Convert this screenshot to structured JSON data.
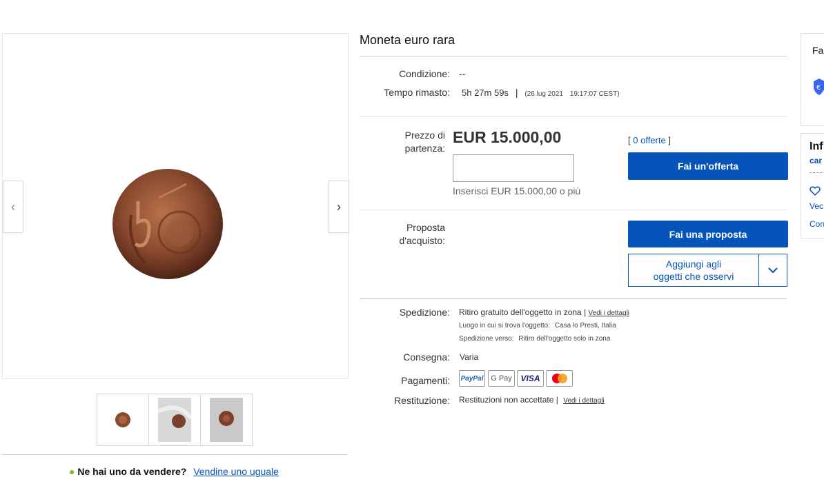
{
  "listing": {
    "title": "Moneta euro rara",
    "condition_label": "Condizione:",
    "condition_value": "--",
    "time_label": "Tempo rimasto:",
    "time_value": "5h 27m 59s",
    "time_separator": "|",
    "end_date": "(26 lug 2021",
    "end_time": "19:17:07 CEST)"
  },
  "bid": {
    "price_label_line1": "Prezzo di",
    "price_label_line2": "partenza:",
    "price": "EUR 15.000,00",
    "offers_open": "[",
    "offers": "0 offerte",
    "offers_close": "]",
    "place_bid_button": "Fai un'offerta",
    "input_value": "",
    "hint": "Inserisci EUR 15.000,00 o più"
  },
  "offer": {
    "label_line1": "Proposta",
    "label_line2": "d'acquisto:",
    "make_offer_button": "Fai una proposta",
    "watch_line1": "Aggiungi agli",
    "watch_line2": "oggetti che osservi"
  },
  "shipping": {
    "label": "Spedizione:",
    "value": "Ritiro gratuito dell'oggetto in zona |",
    "details_link": "Vedi i dettagli",
    "location_label": "Luogo in cui si trova l'oggetto:",
    "location_value": "Casa lo Presti, Italia",
    "ships_to_label": "Spedizione verso:",
    "ships_to_value": "Ritiro dell'oggetto solo in zona"
  },
  "delivery": {
    "label": "Consegna:",
    "value": "Varia"
  },
  "payments": {
    "label": "Pagamenti:",
    "methods": [
      "PayPal",
      "G Pay",
      "VISA",
      "mastercard"
    ]
  },
  "returns": {
    "label": "Restituzione:",
    "value": "Restituzioni non accettate |",
    "details_link": "Vedi i dettagli"
  },
  "sell": {
    "text": "Ne hai uno da vendere?",
    "link": "Vendine uno uguale"
  },
  "sidebar": {
    "card1_title": "Fa",
    "card2_title": "Inf",
    "card2_sub": "car",
    "card2_link1": "Vec",
    "card2_link2": "Con"
  },
  "colors": {
    "accent": "#0654ba",
    "border": "#e5e5e5"
  }
}
